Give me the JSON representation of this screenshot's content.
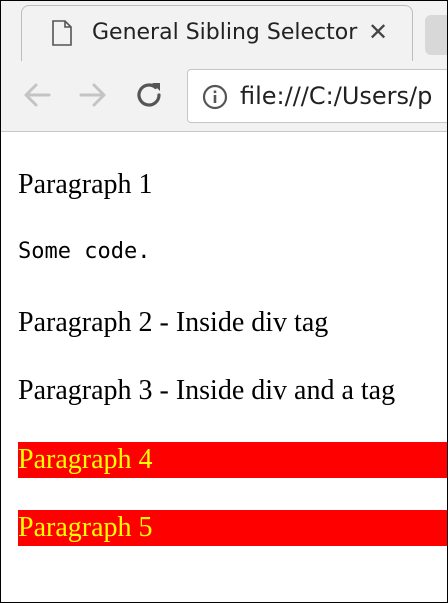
{
  "tab": {
    "title": "General Sibling Selector",
    "close_glyph": "✕"
  },
  "toolbar": {
    "url": "file:///C:/Users/p"
  },
  "content": {
    "paragraph_1": "Paragraph 1",
    "code": "Some code.",
    "paragraph_2": "Paragraph 2 - Inside div tag",
    "paragraph_3": "Paragraph 3 - Inside div and a tag",
    "paragraph_4": "Paragraph 4",
    "paragraph_5": "Paragraph 5"
  },
  "colors": {
    "highlight_background": "#ff0000",
    "highlight_text": "#ffff00"
  },
  "icons": [
    "document-icon",
    "close-icon",
    "back-icon",
    "forward-icon",
    "reload-icon",
    "info-icon"
  ]
}
